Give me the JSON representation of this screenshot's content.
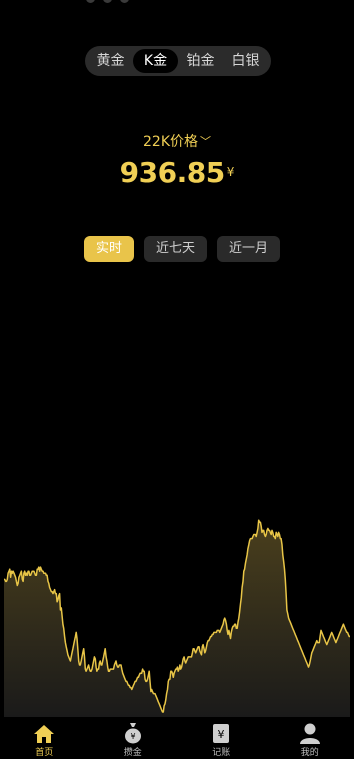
{
  "metal_tabs": [
    "黄金",
    "K金",
    "铂金",
    "白银"
  ],
  "active_metal_index": 1,
  "price": {
    "label": "22K价格",
    "value": "936.85",
    "currency": "¥"
  },
  "range_tabs": [
    "实时",
    "近七天",
    "近一月"
  ],
  "active_range_index": 0,
  "chart_data": {
    "type": "area",
    "line_color": "#e8c547",
    "fill_color": "#3d3418",
    "values": [
      66,
      66,
      65,
      65,
      66,
      69,
      70,
      71,
      67,
      70,
      69,
      70,
      69,
      68,
      67,
      65,
      63,
      64,
      67,
      68,
      69,
      70,
      66,
      65,
      69,
      70,
      68,
      69,
      68,
      70,
      70,
      68,
      68,
      69,
      70,
      70,
      70,
      69,
      68,
      68,
      71,
      71,
      72,
      70,
      72,
      71,
      70,
      70,
      69,
      69,
      69,
      68,
      68,
      65,
      64,
      62,
      61,
      60,
      60,
      59,
      60,
      61,
      59,
      59,
      55,
      56,
      58,
      59,
      51,
      52,
      48,
      44,
      42,
      38,
      35,
      33,
      31,
      29,
      28,
      27,
      26,
      28,
      30,
      32,
      34,
      36,
      38,
      40,
      37,
      32,
      26,
      24,
      24,
      26,
      28,
      30,
      32,
      28,
      22,
      21,
      22,
      23,
      24,
      22,
      21,
      21,
      22,
      24,
      26,
      28,
      27,
      23,
      21,
      22,
      22,
      25,
      26,
      24,
      24,
      26,
      28,
      30,
      32,
      28,
      26,
      23,
      21,
      21,
      22,
      22,
      22,
      22,
      22,
      24,
      25,
      26,
      24,
      23,
      23,
      24,
      24,
      24,
      22,
      20,
      19,
      18,
      17,
      16,
      16,
      15,
      14,
      14,
      13,
      13,
      12,
      13,
      14,
      15,
      16,
      16,
      17,
      18,
      18,
      19,
      20,
      20,
      20,
      22,
      21,
      21,
      17,
      16,
      16,
      17,
      19,
      21,
      16,
      11,
      12,
      11,
      10,
      10,
      10,
      9,
      8,
      7,
      6,
      5,
      4,
      3,
      2,
      1,
      1,
      4,
      5,
      7,
      10,
      12,
      16,
      17,
      17,
      21,
      21,
      20,
      18,
      20,
      21,
      22,
      22,
      23,
      21,
      22,
      24,
      22,
      23,
      25,
      27,
      28,
      26,
      25,
      26,
      27,
      28,
      28,
      28,
      28,
      28,
      30,
      32,
      32,
      31,
      30,
      31,
      32,
      33,
      33,
      31,
      30,
      29,
      33,
      34,
      32,
      30,
      31,
      33,
      35,
      36,
      36,
      37,
      38,
      38,
      39,
      39,
      40,
      40,
      40,
      40,
      41,
      41,
      41,
      40,
      41,
      42,
      43,
      44,
      46,
      47,
      46,
      44,
      41,
      39,
      41,
      39,
      37,
      40,
      42,
      43,
      43,
      44,
      44,
      42,
      42,
      45,
      47,
      50,
      54,
      57,
      62,
      65,
      70,
      71,
      74,
      76,
      78,
      81,
      83,
      85,
      86,
      86,
      86,
      87,
      88,
      88,
      88,
      87,
      89,
      91,
      95,
      94,
      94,
      92,
      89,
      90,
      90,
      88,
      87,
      88,
      90,
      91,
      90,
      90,
      89,
      88,
      90,
      89,
      87,
      87,
      86,
      89,
      88,
      87,
      89,
      88,
      86,
      86,
      83,
      78,
      75,
      71,
      66,
      59,
      51,
      49,
      47,
      46,
      45,
      44,
      43,
      42,
      41,
      40,
      39,
      38,
      37,
      36,
      35,
      34,
      33,
      32,
      31,
      30,
      29,
      28,
      27,
      26,
      25,
      24,
      23,
      24,
      26,
      28,
      30,
      31,
      32,
      33,
      34,
      35,
      36,
      35,
      35,
      35,
      38,
      41,
      40,
      39,
      38,
      37,
      36,
      35,
      34,
      35,
      36,
      37,
      38,
      39,
      40,
      39,
      38,
      37,
      36,
      35,
      36,
      37,
      38,
      39,
      40,
      41,
      42,
      43,
      44,
      43,
      42,
      41,
      40,
      40,
      39,
      38,
      38
    ]
  },
  "bottom_nav": [
    {
      "label": "首页",
      "icon": "home-icon"
    },
    {
      "label": "攒金",
      "icon": "money-bag-icon"
    },
    {
      "label": "记账",
      "icon": "ledger-icon"
    },
    {
      "label": "我的",
      "icon": "user-icon"
    }
  ],
  "active_nav_index": 0
}
